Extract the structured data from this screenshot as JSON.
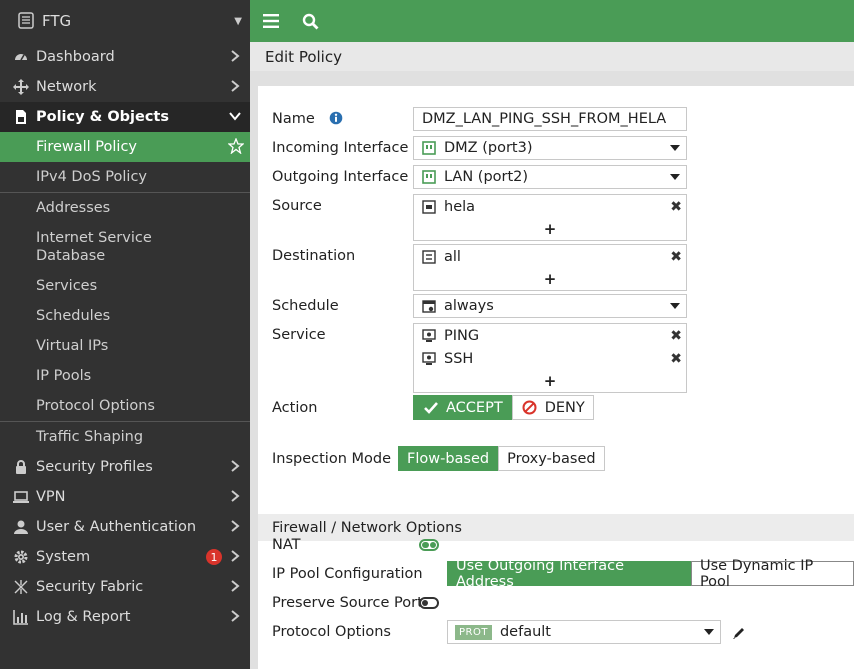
{
  "brand": {
    "name": "FTG"
  },
  "sidebar": {
    "items": [
      {
        "label": "Dashboard",
        "icon": "dashboard-icon"
      },
      {
        "label": "Network",
        "icon": "network-icon"
      },
      {
        "label": "Policy & Objects",
        "icon": "policy-icon"
      },
      {
        "label": "Firewall Policy"
      },
      {
        "label": "IPv4 DoS Policy"
      },
      {
        "label": "Addresses"
      },
      {
        "label": "Internet Service Database"
      },
      {
        "label": "Services"
      },
      {
        "label": "Schedules"
      },
      {
        "label": "Virtual IPs"
      },
      {
        "label": "IP Pools"
      },
      {
        "label": "Protocol Options"
      },
      {
        "label": "Traffic Shaping"
      },
      {
        "label": "Security Profiles",
        "icon": "lock-icon"
      },
      {
        "label": "VPN",
        "icon": "vpn-icon"
      },
      {
        "label": "User & Authentication",
        "icon": "user-icon"
      },
      {
        "label": "System",
        "icon": "gear-icon",
        "badge": "1"
      },
      {
        "label": "Security Fabric",
        "icon": "fabric-icon"
      },
      {
        "label": "Log & Report",
        "icon": "chart-icon"
      }
    ]
  },
  "header": {
    "title": "Edit Policy"
  },
  "form": {
    "name_label": "Name",
    "name_value": "DMZ_LAN_PING_SSH_FROM_HELA",
    "incoming_label": "Incoming Interface",
    "incoming_value": "DMZ (port3)",
    "outgoing_label": "Outgoing Interface",
    "outgoing_value": "LAN (port2)",
    "source_label": "Source",
    "source_entries": [
      "hela"
    ],
    "destination_label": "Destination",
    "destination_entries": [
      "all"
    ],
    "schedule_label": "Schedule",
    "schedule_value": "always",
    "service_label": "Service",
    "service_entries": [
      "PING",
      "SSH"
    ],
    "add_symbol": "+",
    "action_label": "Action",
    "action_accept": "ACCEPT",
    "action_deny": "DENY",
    "inspection_label": "Inspection Mode",
    "inspection_flow": "Flow-based",
    "inspection_proxy": "Proxy-based"
  },
  "firewall_options": {
    "section_title": "Firewall / Network Options",
    "nat_label": "NAT",
    "nat_enabled": true,
    "ippool_label": "IP Pool Configuration",
    "ippool_outgoing": "Use Outgoing Interface Address",
    "ippool_dynamic": "Use Dynamic IP Pool",
    "preserve_label": "Preserve Source Port",
    "preserve_enabled": false,
    "protocol_label": "Protocol Options",
    "protocol_tag": "PROT",
    "protocol_value": "default"
  },
  "colors": {
    "accent": "#4a9c56",
    "sidebar": "#323232",
    "badge": "#d9342b"
  }
}
